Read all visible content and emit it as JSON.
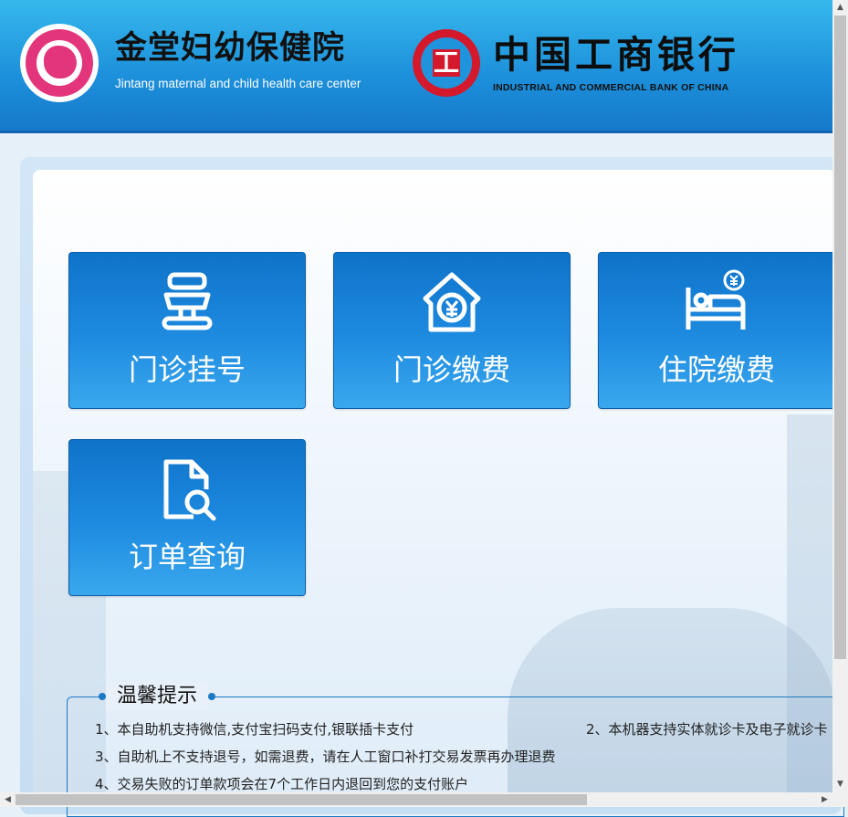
{
  "header": {
    "hospital_name": "金堂妇幼保健院",
    "hospital_name_en": "Jintang maternal and child health care center",
    "bank_name": "中国工商银行",
    "bank_name_en": "INDUSTRIAL AND COMMERCIAL BANK OF CHINA",
    "bank_logo_glyph": "工"
  },
  "tiles": [
    {
      "label": "门诊挂号",
      "icon": "registration-icon"
    },
    {
      "label": "门诊缴费",
      "icon": "house-yuan-icon"
    },
    {
      "label": "住院缴费",
      "icon": "hospital-bed-yuan-icon"
    },
    {
      "label": "订单查询",
      "icon": "document-search-icon"
    }
  ],
  "tips": {
    "title": "温馨提示",
    "items": [
      "1、本自助机支持微信,支付宝扫码支付,银联插卡支付",
      "2、本机器支持实体就诊卡及电子就诊卡",
      "3、自助机上不支持退号，如需退费，请在人工窗口补打交易发票再办理退费",
      "4、交易失败的订单款项会在7个工作日内退回到您的支付账户"
    ]
  },
  "colors": {
    "header_blue": "#1c8fdb",
    "tile_blue": "#1e8be0",
    "hospital_pink": "#e3357b",
    "bank_red": "#d4192c"
  }
}
